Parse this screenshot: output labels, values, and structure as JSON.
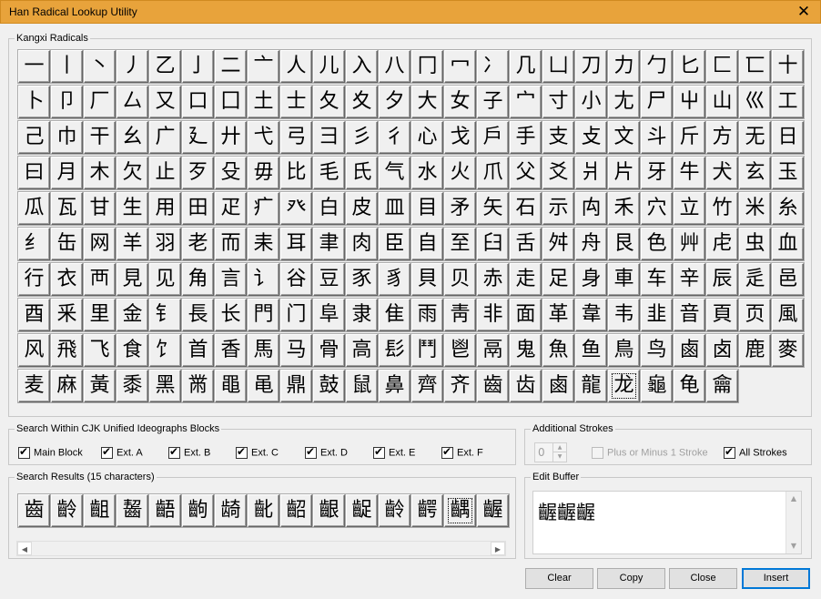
{
  "window": {
    "title": "Han Radical Lookup Utility",
    "close_glyph": "✕"
  },
  "radicals": {
    "label": "Kangxi Radicals",
    "selected_index": 234,
    "items": [
      "一",
      "丨",
      "丶",
      "丿",
      "乙",
      "亅",
      "二",
      "亠",
      "人",
      "儿",
      "入",
      "八",
      "冂",
      "冖",
      "冫",
      "几",
      "凵",
      "刀",
      "力",
      "勹",
      "匕",
      "匚",
      "匸",
      "十",
      "卜",
      "卩",
      "厂",
      "厶",
      "又",
      "口",
      "囗",
      "土",
      "士",
      "夂",
      "夊",
      "夕",
      "大",
      "女",
      "子",
      "宀",
      "寸",
      "小",
      "尢",
      "尸",
      "屮",
      "山",
      "巛",
      "工",
      "己",
      "巾",
      "干",
      "幺",
      "广",
      "廴",
      "廾",
      "弋",
      "弓",
      "彐",
      "彡",
      "彳",
      "心",
      "戈",
      "戶",
      "手",
      "支",
      "攴",
      "文",
      "斗",
      "斤",
      "方",
      "无",
      "日",
      "曰",
      "月",
      "木",
      "欠",
      "止",
      "歹",
      "殳",
      "毋",
      "比",
      "毛",
      "氏",
      "气",
      "水",
      "火",
      "爪",
      "父",
      "爻",
      "爿",
      "片",
      "牙",
      "牛",
      "犬",
      "玄",
      "玉",
      "瓜",
      "瓦",
      "甘",
      "生",
      "用",
      "田",
      "疋",
      "疒",
      "癶",
      "白",
      "皮",
      "皿",
      "目",
      "矛",
      "矢",
      "石",
      "示",
      "禸",
      "禾",
      "穴",
      "立",
      "竹",
      "米",
      "糸",
      "纟",
      "缶",
      "网",
      "羊",
      "羽",
      "老",
      "而",
      "耒",
      "耳",
      "聿",
      "肉",
      "臣",
      "自",
      "至",
      "臼",
      "舌",
      "舛",
      "舟",
      "艮",
      "色",
      "艸",
      "虍",
      "虫",
      "血",
      "行",
      "衣",
      "襾",
      "見",
      "见",
      "角",
      "言",
      "讠",
      "谷",
      "豆",
      "豕",
      "豸",
      "貝",
      "贝",
      "赤",
      "走",
      "足",
      "身",
      "車",
      "车",
      "辛",
      "辰",
      "辵",
      "邑",
      "酉",
      "釆",
      "里",
      "金",
      "钅",
      "長",
      "长",
      "門",
      "门",
      "阜",
      "隶",
      "隹",
      "雨",
      "靑",
      "非",
      "面",
      "革",
      "韋",
      "韦",
      "韭",
      "音",
      "頁",
      "页",
      "風",
      "风",
      "飛",
      "飞",
      "食",
      "饣",
      "首",
      "香",
      "馬",
      "马",
      "骨",
      "高",
      "髟",
      "鬥",
      "鬯",
      "鬲",
      "鬼",
      "魚",
      "鱼",
      "鳥",
      "鸟",
      "鹵",
      "卤",
      "鹿",
      "麥",
      "麦",
      "麻",
      "黃",
      "黍",
      "黑",
      "黹",
      "黽",
      "黾",
      "鼎",
      "鼓",
      "鼠",
      "鼻",
      "齊",
      "齐",
      "齒",
      "齿",
      "⿄",
      "龍",
      "龙",
      "龜",
      "龟",
      "龠"
    ]
  },
  "search_blocks": {
    "label": "Search Within CJK Unified Ideographs Blocks",
    "options": [
      {
        "label": "Main Block",
        "checked": true
      },
      {
        "label": "Ext. A",
        "checked": true
      },
      {
        "label": "Ext. B",
        "checked": true
      },
      {
        "label": "Ext. C",
        "checked": true
      },
      {
        "label": "Ext. D",
        "checked": true
      },
      {
        "label": "Ext. E",
        "checked": true
      },
      {
        "label": "Ext. F",
        "checked": true
      }
    ]
  },
  "additional_strokes": {
    "label": "Additional Strokes",
    "value": "0",
    "plus_minus": {
      "label": "Plus or Minus 1 Stroke",
      "checked": false,
      "disabled": true
    },
    "all_strokes": {
      "label": "All Strokes",
      "checked": true
    }
  },
  "search_results": {
    "label": "Search Results (15 characters)",
    "selected_index": 13,
    "items": [
      "齒",
      "齡",
      "齟",
      "齧",
      "齬",
      "齣",
      "𬺈",
      "齔",
      "齠",
      "齦",
      "齪",
      "齡",
      "齶",
      "齵",
      "齷"
    ]
  },
  "edit_buffer": {
    "label": "Edit Buffer",
    "text": "齷齷齷"
  },
  "buttons": {
    "clear": "Clear",
    "copy": "Copy",
    "close": "Close",
    "insert": "Insert"
  }
}
